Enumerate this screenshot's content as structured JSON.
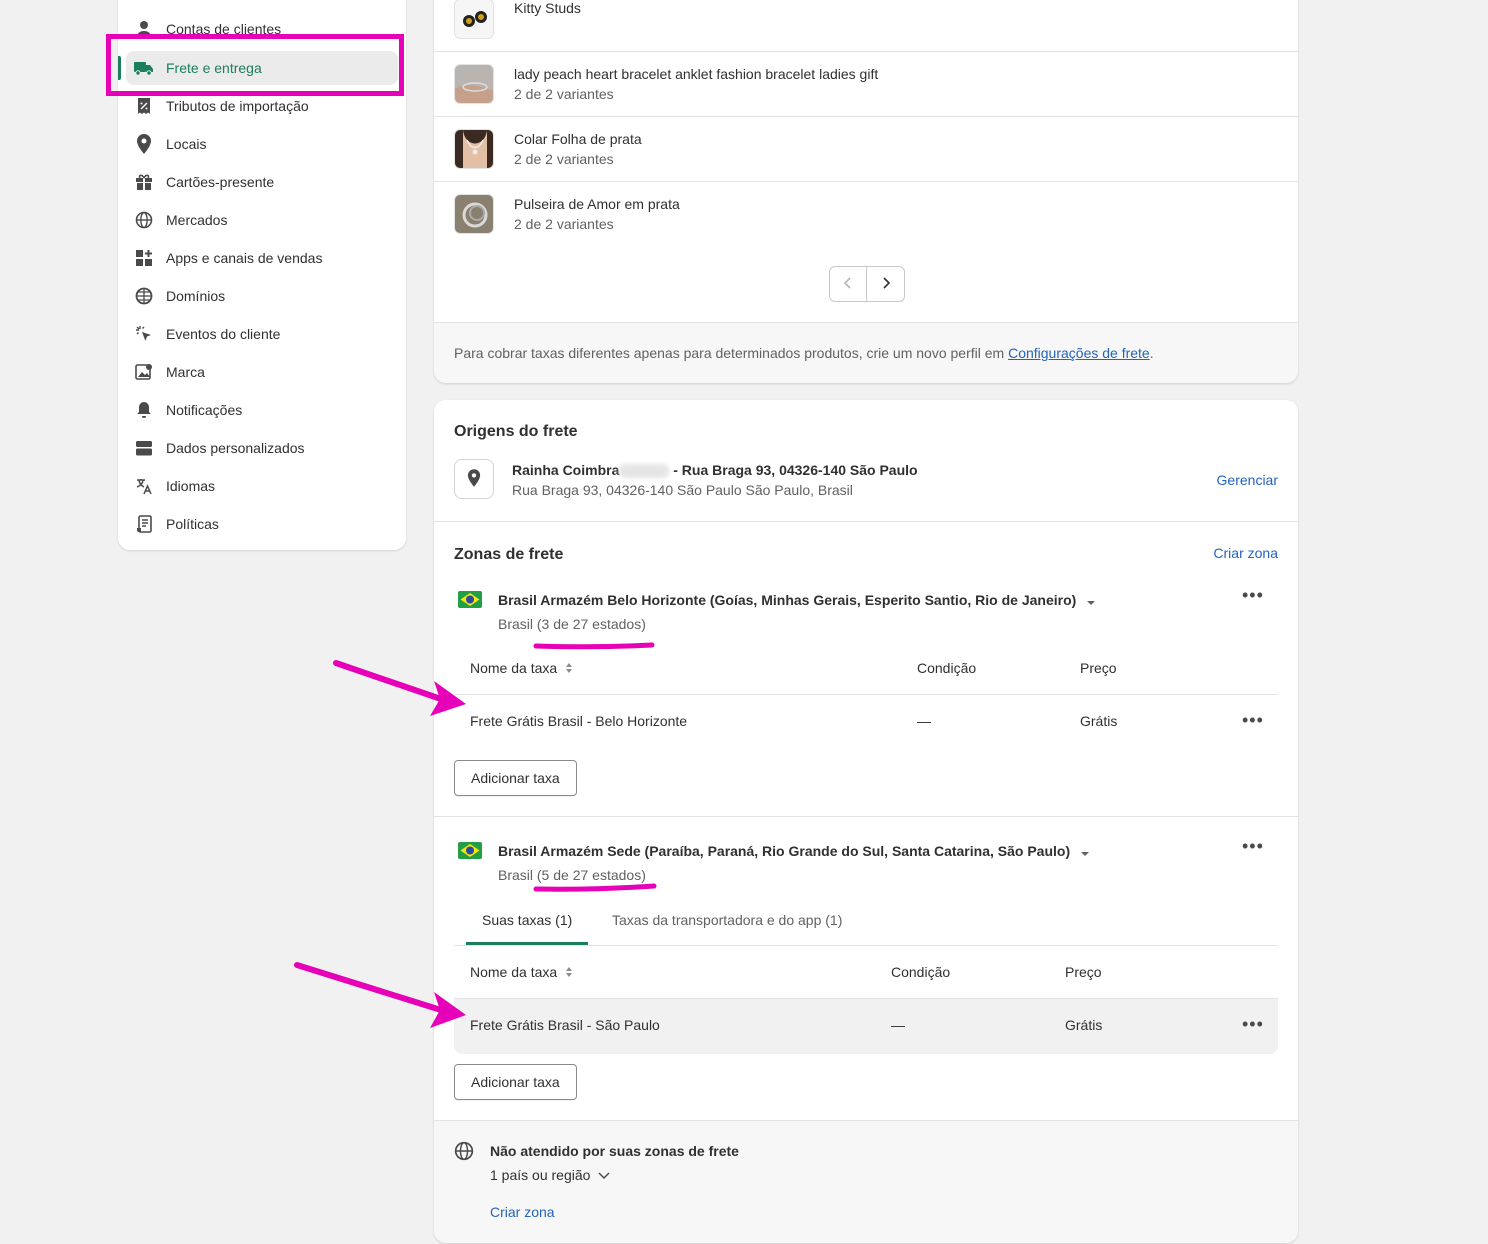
{
  "sidebar": {
    "items": [
      {
        "label": "Contas de clientes",
        "icon": "person-icon"
      },
      {
        "label": "Frete e entrega",
        "icon": "truck-icon",
        "active": true
      },
      {
        "label": "Tributos de importação",
        "icon": "receipt-icon"
      },
      {
        "label": "Locais",
        "icon": "location-pin-icon"
      },
      {
        "label": "Cartões-presente",
        "icon": "gift-icon"
      },
      {
        "label": "Mercados",
        "icon": "globe-icon"
      },
      {
        "label": "Apps e canais de vendas",
        "icon": "apps-icon"
      },
      {
        "label": "Domínios",
        "icon": "globe-grid-icon"
      },
      {
        "label": "Eventos do cliente",
        "icon": "cursor-click-icon"
      },
      {
        "label": "Marca",
        "icon": "brand-icon"
      },
      {
        "label": "Notificações",
        "icon": "bell-icon"
      },
      {
        "label": "Dados personalizados",
        "icon": "database-icon"
      },
      {
        "label": "Idiomas",
        "icon": "translate-icon"
      },
      {
        "label": "Políticas",
        "icon": "document-icon"
      }
    ]
  },
  "products": [
    {
      "title": "Kitty Studs",
      "subtitle": ""
    },
    {
      "title": "lady peach heart bracelet anklet fashion bracelet ladies gift",
      "subtitle": "2 de 2 variantes"
    },
    {
      "title": "Colar Folha de prata",
      "subtitle": "2 de 2 variantes"
    },
    {
      "title": "Pulseira de Amor em prata",
      "subtitle": "2 de 2 variantes"
    }
  ],
  "products_footer": {
    "text": "Para cobrar taxas diferentes apenas para determinados produtos, crie um novo perfil em ",
    "link": "Configurações de frete",
    "suffix": "."
  },
  "origins": {
    "title": "Origens do frete",
    "name_prefix": "Rainha Coimbra",
    "name_suffix": " - Rua Braga 93, 04326-140 São Paulo",
    "address": "Rua Braga 93, 04326-140 São Paulo São Paulo, Brasil",
    "manage": "Gerenciar"
  },
  "zones": {
    "title": "Zonas de frete",
    "create": "Criar zona",
    "list": [
      {
        "name": "Brasil Armazém Belo Horizonte (Goías, Minhas Gerais, Esperito Santio, Rio de Janeiro)",
        "region": "Brasil (3 de 27 estados)",
        "columns": {
          "name": "Nome da taxa",
          "condition": "Condição",
          "price": "Preço"
        },
        "rates": [
          {
            "name": "Frete Grátis Brasil - Belo Horizonte",
            "condition": "—",
            "price": "Grátis"
          }
        ],
        "add_rate": "Adicionar taxa"
      },
      {
        "name": "Brasil Armazém Sede (Paraíba, Paraná, Rio Grande do Sul, Santa Catarina, São Paulo)",
        "region": "Brasil (5 de 27 estados)",
        "tabs": [
          "Suas taxas (1)",
          "Taxas da transportadora e do app (1)"
        ],
        "columns": {
          "name": "Nome da taxa",
          "condition": "Condição",
          "price": "Preço"
        },
        "rates": [
          {
            "name": "Frete Grátis Brasil - São Paulo",
            "condition": "—",
            "price": "Grátis"
          }
        ],
        "add_rate": "Adicionar taxa"
      }
    ]
  },
  "not_served": {
    "title": "Não atendido por suas zonas de frete",
    "count": "1 país ou região",
    "create": "Criar zona"
  },
  "colors": {
    "annotation": "#e600b8",
    "active_green": "#1a7f5a",
    "link_blue": "#2463bc"
  }
}
